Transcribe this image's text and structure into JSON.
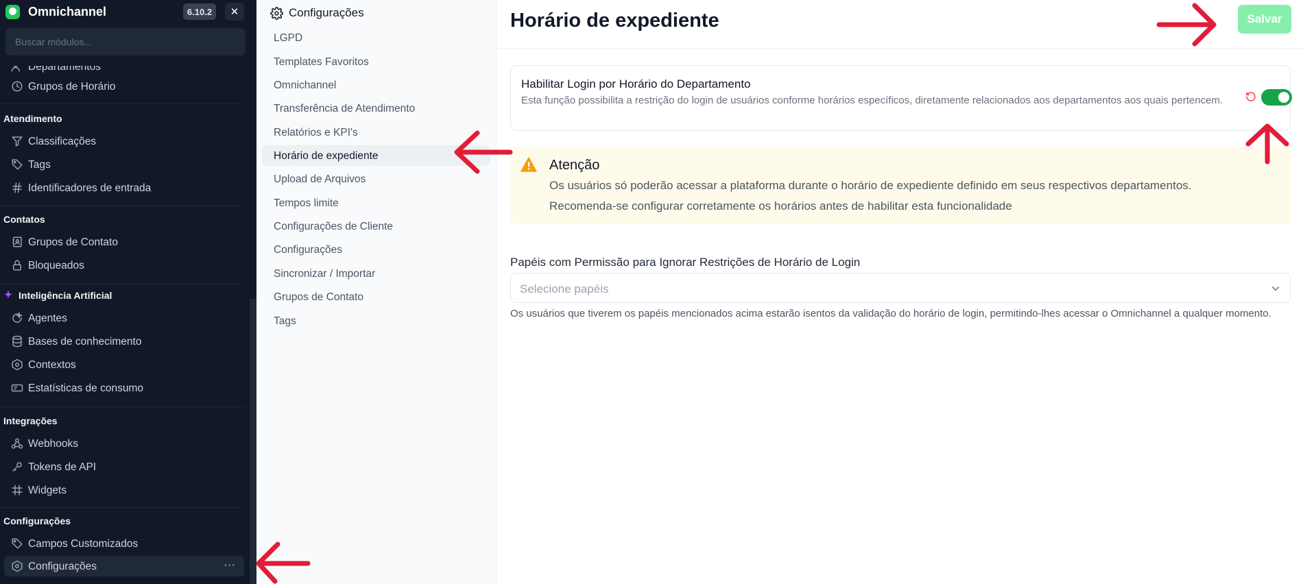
{
  "app": {
    "name": "Omnichannel",
    "version": "6.10.2",
    "close_glyph": "✕",
    "search_placeholder": "Buscar módulos..."
  },
  "sidebar": {
    "partial_item": {
      "label": "Departamentos",
      "icon": "users-icon"
    },
    "group_hours": {
      "label": "Grupos de Horário",
      "icon": "clock-icon"
    },
    "atendimento": {
      "title": "Atendimento",
      "items": [
        {
          "label": "Classificações",
          "icon": "filter-icon"
        },
        {
          "label": "Tags",
          "icon": "tag-icon"
        },
        {
          "label": "Identificadores de entrada",
          "icon": "hash-icon"
        }
      ]
    },
    "contatos": {
      "title": "Contatos",
      "items": [
        {
          "label": "Grupos de Contato",
          "icon": "contact-book-icon"
        },
        {
          "label": "Bloqueados",
          "icon": "lock-icon"
        }
      ]
    },
    "ia": {
      "title": "Inteligência Artificial",
      "items": [
        {
          "label": "Agentes",
          "icon": "bot-icon"
        },
        {
          "label": "Bases de conhecimento",
          "icon": "database-icon"
        },
        {
          "label": "Contextos",
          "icon": "hexagon-icon"
        },
        {
          "label": "Estatísticas de consumo",
          "icon": "chart-card-icon"
        }
      ]
    },
    "integracoes": {
      "title": "Integrações",
      "items": [
        {
          "label": "Webhooks",
          "icon": "webhook-icon"
        },
        {
          "label": "Tokens de API",
          "icon": "key-icon"
        },
        {
          "label": "Widgets",
          "icon": "grid-hash-icon"
        }
      ]
    },
    "configuracoes": {
      "title": "Configurações",
      "items": [
        {
          "label": "Campos Customizados",
          "icon": "tag-icon"
        },
        {
          "label": "Configurações",
          "icon": "settings-hex-icon",
          "active": true,
          "more": "···"
        }
      ]
    }
  },
  "settings_nav": {
    "title": "Configurações",
    "items": [
      {
        "label": "LGPD"
      },
      {
        "label": "Templates Favoritos"
      },
      {
        "label": "Omnichannel"
      },
      {
        "label": "Transferência de Atendimento"
      },
      {
        "label": "Relatórios e KPI's"
      },
      {
        "label": "Horário de expediente",
        "active": true
      },
      {
        "label": "Upload de Arquivos"
      },
      {
        "label": "Tempos limite"
      },
      {
        "label": "Configurações de Cliente"
      },
      {
        "label": "Configurações"
      },
      {
        "label": "Sincronizar / Importar"
      },
      {
        "label": "Grupos de Contato"
      },
      {
        "label": "Tags"
      }
    ]
  },
  "main": {
    "title": "Horário de expediente",
    "save_label": "Salvar",
    "login_setting": {
      "title": "Habilitar Login por Horário do Departamento",
      "description": "Esta função possibilita a restrição do login de usuários conforme horários específicos, diretamente relacionados aos departamentos aos quais pertencem.",
      "enabled": true
    },
    "alert": {
      "title": "Atenção",
      "line1": "Os usuários só poderão acessar a plataforma durante o horário de expediente definido em seus respectivos departamentos.",
      "line2": "Recomenda-se configurar corretamente os horários antes de habilitar esta funcionalidade"
    },
    "roles_field": {
      "label": "Papéis com Permissão para Ignorar Restrições de Horário de Login",
      "placeholder": "Selecione papéis",
      "help": "Os usuários que tiverem os papéis mencionados acima estarão isentos da validação do horário de login, permitindo-lhes acessar o Omnichannel a qualquer momento."
    }
  },
  "colors": {
    "sidebar_bg": "#111827",
    "accent_green": "#16a34a",
    "save_disabled": "#86efac",
    "alert_bg": "#fffbeb",
    "warning": "#f59e0b",
    "annotation_red": "#e11d38"
  }
}
